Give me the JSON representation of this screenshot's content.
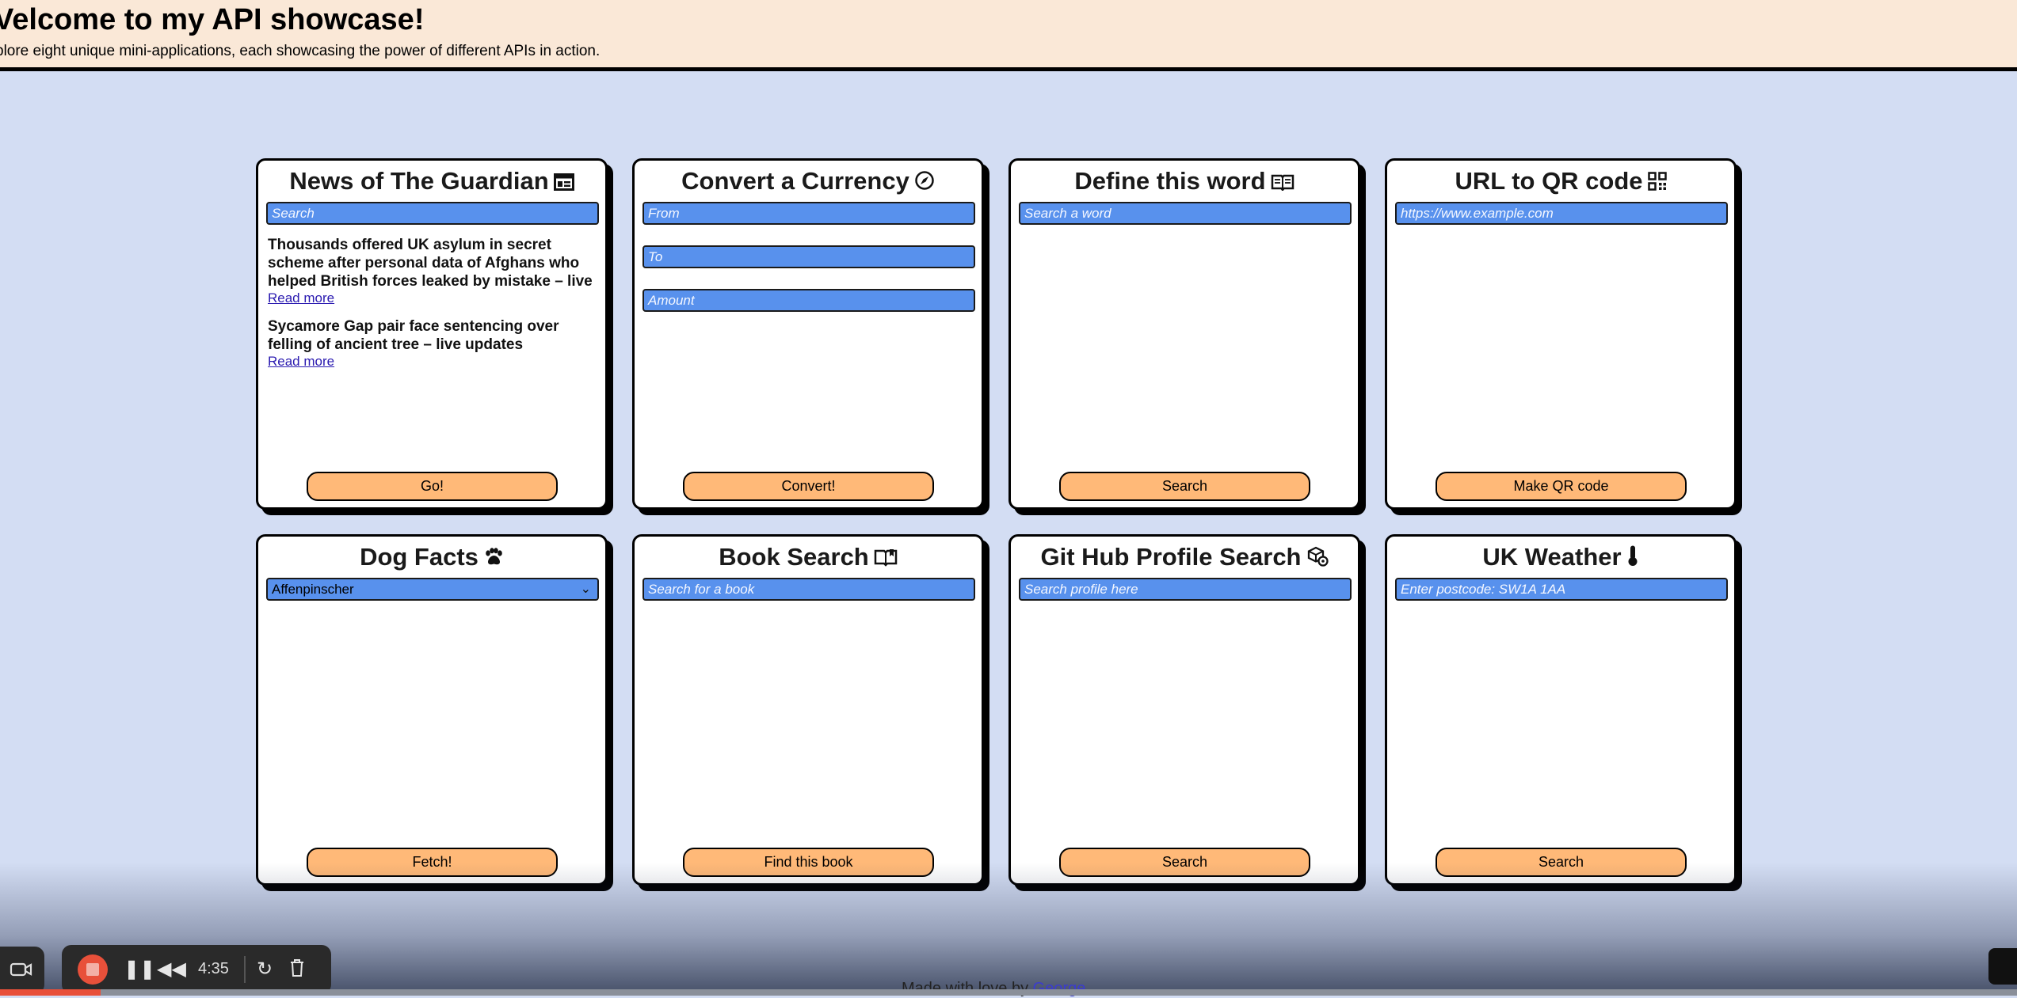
{
  "header": {
    "title": "Velcome to my API showcase!",
    "subtitle": "plore eight unique mini-applications, each showcasing the power of different APIs in action."
  },
  "cards": [
    {
      "title": "News of The Guardian",
      "icon": "newspaper-icon",
      "placeholder": "Search",
      "button": "Go!",
      "news": [
        {
          "title": "Thousands offered UK asylum in secret scheme after personal data of Afghans who helped British forces leaked by mistake – live",
          "link": "Read more"
        },
        {
          "title": "Sycamore Gap pair face sentencing over felling of ancient tree – live updates",
          "link": "Read more"
        }
      ]
    },
    {
      "title": "Convert a Currency",
      "icon": "compass-icon",
      "fields": [
        "From",
        "To",
        "Amount"
      ],
      "button": "Convert!"
    },
    {
      "title": "Define this word",
      "icon": "open-book-icon",
      "placeholder": "Search a word",
      "button": "Search"
    },
    {
      "title": "URL to QR code",
      "icon": "qr-code-icon",
      "placeholder": "https://www.example.com",
      "button": "Make QR code"
    },
    {
      "title": "Dog Facts",
      "icon": "paw-icon",
      "selected": "Affenpinscher",
      "button": "Fetch!"
    },
    {
      "title": "Book Search",
      "icon": "book-icon",
      "placeholder": "Search for a book",
      "button": "Find this book"
    },
    {
      "title": "Git Hub Profile Search",
      "icon": "github-icon",
      "placeholder": "Search profile here",
      "button": "Search"
    },
    {
      "title": "UK Weather",
      "icon": "thermometer-icon",
      "placeholder": "Enter postcode: SW1A 1AA",
      "button": "Search"
    }
  ],
  "footer": {
    "text": "Made with love by",
    "author": "George"
  },
  "recorder": {
    "time": "4:35",
    "progress": 0.05
  }
}
